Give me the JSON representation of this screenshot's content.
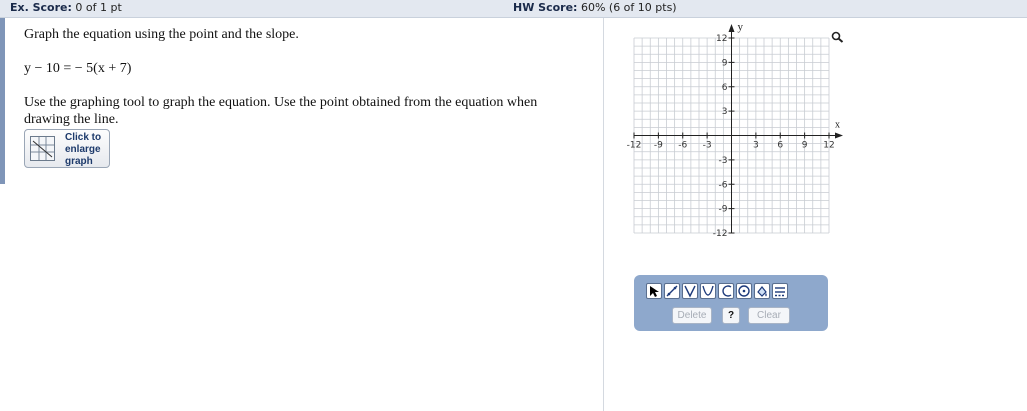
{
  "header": {
    "ex_score_label": "Ex. Score:",
    "ex_score_value": "0 of 1 pt",
    "hw_score_label": "HW Score:",
    "hw_score_value": "60% (6 of 10 pts)"
  },
  "question": {
    "instruction": "Graph the equation using the point and the slope.",
    "equation": "y − 10 = − 5(x + 7)",
    "tool_instruction_line1": "Use the graphing tool to graph the equation. Use the point obtained from the equation when",
    "tool_instruction_line2": "drawing the line."
  },
  "enlarge_button": {
    "line1": "Click to",
    "line2": "enlarge",
    "line3": "graph"
  },
  "graph": {
    "x_axis_label": "x",
    "y_axis_label": "y",
    "x_ticks": [
      "-12",
      "-9",
      "-6",
      "-3",
      "3",
      "6",
      "9",
      "12"
    ],
    "y_ticks": [
      "12",
      "9",
      "6",
      "3",
      "-3",
      "-6",
      "-9",
      "-12"
    ],
    "range": [
      -12,
      12
    ],
    "grid": true
  },
  "toolbar": {
    "tools": [
      "pointer-tool",
      "line-tool",
      "absolute-value-tool",
      "parabola-tool",
      "open-curve-tool",
      "circle-tool",
      "fill-tool",
      "inequality-tool"
    ],
    "delete_label": "Delete",
    "help_label": "?",
    "clear_label": "Clear",
    "background_color": "#8ea8cc"
  }
}
